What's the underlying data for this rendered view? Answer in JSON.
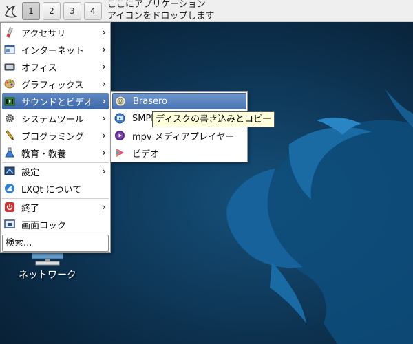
{
  "panel": {
    "desktops": [
      "1",
      "2",
      "3",
      "4"
    ],
    "active_desktop": "1",
    "quicklaunch_hint": [
      "ここにアプリケーション",
      "アイコンをドロップします"
    ]
  },
  "menu": {
    "items": [
      {
        "label": "アクセサリ",
        "icon": "accessories-icon",
        "submenu": true
      },
      {
        "label": "インターネット",
        "icon": "internet-icon",
        "submenu": true
      },
      {
        "label": "オフィス",
        "icon": "office-icon",
        "submenu": true
      },
      {
        "label": "グラフィックス",
        "icon": "graphics-icon",
        "submenu": true
      },
      {
        "label": "サウンドとビデオ",
        "icon": "sound-video-icon",
        "submenu": true,
        "highlighted": true
      },
      {
        "label": "システムツール",
        "icon": "system-tools-icon",
        "submenu": true
      },
      {
        "label": "プログラミング",
        "icon": "programming-icon",
        "submenu": true
      },
      {
        "label": "教育・教養",
        "icon": "education-icon",
        "submenu": true
      }
    ],
    "settings": {
      "label": "設定",
      "icon": "settings-icon"
    },
    "about": {
      "label": "LXQt について",
      "icon": "lxqt-icon"
    },
    "leave": {
      "label": "終了",
      "icon": "power-icon"
    },
    "lock": {
      "label": "画面ロック",
      "icon": "lock-screen-icon"
    },
    "search_placeholder": "検索..."
  },
  "submenu": {
    "items": [
      {
        "label": "Brasero",
        "icon": "brasero-icon",
        "highlighted": true
      },
      {
        "label": "SMPla",
        "icon": "smplayer-icon"
      },
      {
        "label": "mpv メディアプレイヤー",
        "icon": "mpv-icon"
      },
      {
        "label": "ビデオ",
        "icon": "video-icon"
      }
    ]
  },
  "tooltip": "ディスクの書き込みとコピー",
  "desktop_icons": [
    {
      "label": "ネットワーク",
      "icon": "network-icon"
    }
  ],
  "colors": {
    "highlight": "#4a74b2",
    "desktop": "#0f3a5c",
    "tooltip_bg": "#ffffdc"
  }
}
